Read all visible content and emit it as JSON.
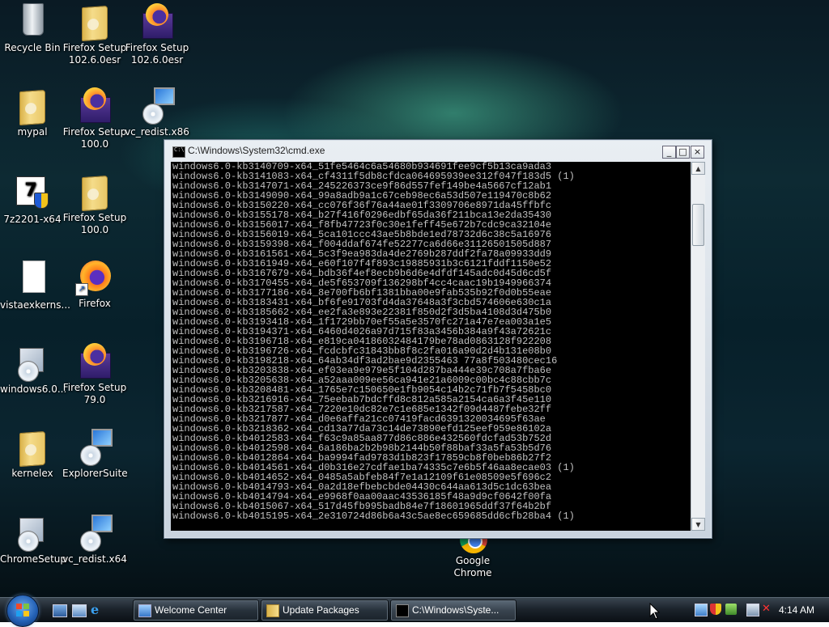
{
  "desktop": {
    "icons": [
      {
        "label": "Recycle Bin"
      },
      {
        "label": "Firefox Setup 102.6.0esr"
      },
      {
        "label": "Firefox Setup 102.6.0esr"
      },
      {
        "label": "mypal"
      },
      {
        "label": "Firefox Setup 100.0"
      },
      {
        "label": "vc_redist.x86"
      },
      {
        "label": "7z2201-x64"
      },
      {
        "label": "Firefox Setup 100.0"
      },
      {
        "label": "vistaexkerns..."
      },
      {
        "label": "Firefox"
      },
      {
        "label": "windows6.0..."
      },
      {
        "label": "Firefox Setup 79.0"
      },
      {
        "label": "kernelex"
      },
      {
        "label": "ExplorerSuite"
      },
      {
        "label": "ChromeSetup"
      },
      {
        "label": "vc_redist.x64"
      },
      {
        "label": "Google Chrome"
      }
    ]
  },
  "cmd": {
    "title": "C:\\Windows\\System32\\cmd.exe",
    "lines": [
      "windows6.0-kb3140709-x64_51fe5464c6a54680b934691fee9cf5b13ca9ada3",
      "windows6.0-kb3141083-x64_cf4311f5db8cfdca064695939ee312f047f183d5 (1)",
      "windows6.0-kb3147071-x64_245226373ce9f86d557fef149be4a5667cf12ab1",
      "windows6.0-kb3149090-x64_99a8adb9a1c67ceb98ec6a53d507e119470c8b62",
      "windows6.0-kb3150220-x64_cc076f36f76a44ae01f3309706e8971da45ffbfc",
      "windows6.0-kb3155178-x64_b27f416f0296edbf65da36f211bca13e2da35430",
      "windows6.0-kb3156017-x64_f8fb47723f0c30e1feff45e672b7cdc9ca32104e",
      "windows6.0-kb3156019-x64_5ca101ccc43ae5b8bde1ed78732d6c38c5a16976",
      "windows6.0-kb3159398-x64_f004ddaf674fe52277ca6d66e31126501505d887",
      "windows6.0-kb3161561-x64_5c3f9ea983da4de2769b287ddf2fa78a09933dd9",
      "windows6.0-kb3161949-x64_e60f107f4f893c19885931b3c6121fddf1150e52",
      "windows6.0-kb3167679-x64_bdb36f4ef8ecb9b6d6e4dfdf145adc0d45d6cd5f",
      "windows6.0-kb3170455-x64_de5f653709f136298bf4cc4caac19b1949966374",
      "windows6.0-kb3177186-x64_8e700fb6bf1381bba00e9fab535b92f0d0b55eae",
      "windows6.0-kb3183431-x64_bf6fe91703fd4da37648a3f3cbd574606e630c1a",
      "windows6.0-kb3185662-x64_ee2fa3e893e22381f850d2f3d5ba4108d3d475b0",
      "windows6.0-kb3193418-x64_1f1729bb70ef55a5e3570fc271a47e7ea003a1e5",
      "windows6.0-kb3194371-x64_6460d4026a97d715f83a3456b384a9f43a72621c",
      "windows6.0-kb3196718-x64_e819ca04186032484179be78ad0863128f922208",
      "windows6.0-kb3196726-x64_fcdcbfc31843bb8f8c2fa016a90d2d4b131e08b0",
      "windows6.0-kb3198218-x64_64ab34df3ad2bae9d2355463 77a8f503480cec16",
      "windows6.0-kb3203838-x64_ef03ea9e979e5f104d287ba444e39c708a7fba6e",
      "windows6.0-kb3205638-x64_a52aaa009ee56ca941e21a6009c00bc4c88cbb7c",
      "windows6.0-kb3208481-x64_1765e7c150650e1fb9054c14b2c71fb7f5458bc0",
      "windows6.0-kb3216916-x64_75eebab7bdcffd8c812a585a2154ca6a3f45e110",
      "windows6.0-kb3217587-x64_7220e10dc82e7c1e685e1342f09d4487febe32ff",
      "windows6.0-kb3217877-x64_d0e6affa21cc07419facd6391320034695f63ae",
      "windows6.0-kb3218362-x64_cd13a77da73c14de73890efd125eef959e86102a",
      "windows6.0-kb4012583-x64_f63c9a85aa877d86c886e432560fdcfad53b752d",
      "windows6.0-kb4012598-x64_6a186ba2b2b98b2144b50f88baf33a5fa53b5d76",
      "windows6.0-kb4012864-x64_ba9994fad9783d1b823f17859cb8f0beb86b27f2",
      "windows6.0-kb4014561-x64_d0b316e27cdfae1ba74335c7e6b5f46aa8ecae03 (1)",
      "windows6.0-kb4014652-x64_0485a5abfeb84f7e1a12109f61e08509e5f696c2",
      "windows6.0-kb4014793-x64_0a2d18efbebcbde04430c644aa613d5c1dc63bea",
      "windows6.0-kb4014794-x64_e9968f0aa00aac43536185f48a9d9cf0642f00fa",
      "windows6.0-kb4015067-x64_517d45fb995badb84e7f18601965ddf37f64b2bf",
      "windows6.0-kb4015195-x64_2e310724d86b6a43c5ae8ec659685dd6cfb28ba4 (1)"
    ],
    "buttons": {
      "minimize": "_",
      "maximize": "□",
      "close": "×"
    }
  },
  "taskbar": {
    "tasks": [
      {
        "label": "Welcome Center"
      },
      {
        "label": "Update Packages"
      },
      {
        "label": "C:\\Windows\\Syste..."
      }
    ],
    "clock": "4:14 AM"
  }
}
